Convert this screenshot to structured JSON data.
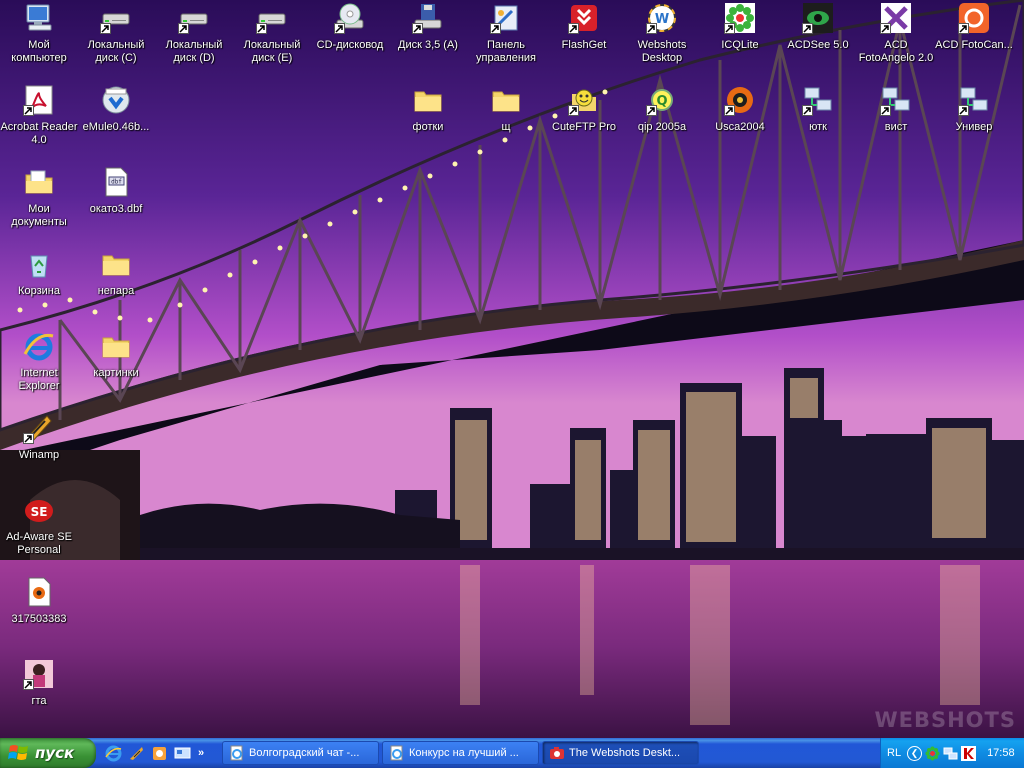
{
  "desktop": {
    "wallpaper_watermark": "WEBSHOTS",
    "icons": [
      {
        "id": "my-computer",
        "label": "Мой компьютер",
        "shortcut": false
      },
      {
        "id": "local-disk-c",
        "label": "Локальный диск (C)",
        "shortcut": true
      },
      {
        "id": "local-disk-d",
        "label": "Локальный диск (D)",
        "shortcut": true
      },
      {
        "id": "local-disk-e",
        "label": "Локальный диск (E)",
        "shortcut": true
      },
      {
        "id": "cd-drive",
        "label": "CD-дисковод",
        "shortcut": true
      },
      {
        "id": "floppy-a",
        "label": "Диск 3,5 (A)",
        "shortcut": true
      },
      {
        "id": "control-panel",
        "label": "Панель управления",
        "shortcut": true
      },
      {
        "id": "flashget",
        "label": "FlashGet",
        "shortcut": true
      },
      {
        "id": "webshots",
        "label": "Webshots Desktop",
        "shortcut": true
      },
      {
        "id": "icqlite",
        "label": "ICQLite",
        "shortcut": true
      },
      {
        "id": "acdsee",
        "label": "ACDSee 5.0",
        "shortcut": true
      },
      {
        "id": "fotoangelo",
        "label": "ACD FotoAngelo 2.0",
        "shortcut": true
      },
      {
        "id": "fotocanvas",
        "label": "ACD FotoCan...",
        "shortcut": true
      },
      {
        "id": "acrobat",
        "label": "Acrobat Reader 4.0",
        "shortcut": true
      },
      {
        "id": "emule",
        "label": "eMule0.46b...",
        "shortcut": false
      },
      {
        "id": "fotki",
        "label": "фотки",
        "shortcut": false
      },
      {
        "id": "sch",
        "label": "щ",
        "shortcut": false
      },
      {
        "id": "cuteftp",
        "label": "CuteFTP Pro",
        "shortcut": true
      },
      {
        "id": "qip",
        "label": "qip 2005a",
        "shortcut": true
      },
      {
        "id": "usca",
        "label": "Usca2004",
        "shortcut": true
      },
      {
        "id": "yutk",
        "label": "ютк",
        "shortcut": true
      },
      {
        "id": "vist",
        "label": "вист",
        "shortcut": true
      },
      {
        "id": "univer",
        "label": "Универ",
        "shortcut": true
      },
      {
        "id": "my-documents",
        "label": "Мои документы",
        "shortcut": false
      },
      {
        "id": "okato",
        "label": "окато3.dbf",
        "shortcut": false
      },
      {
        "id": "recycle-bin",
        "label": "Корзина",
        "shortcut": false
      },
      {
        "id": "nepara",
        "label": "непара",
        "shortcut": false
      },
      {
        "id": "internet-explorer",
        "label": "Internet Explorer",
        "shortcut": false
      },
      {
        "id": "kartinki",
        "label": "картинки",
        "shortcut": false
      },
      {
        "id": "winamp",
        "label": "Winamp",
        "shortcut": true
      },
      {
        "id": "adaware",
        "label": "Ad-Aware SE Personal",
        "shortcut": false
      },
      {
        "id": "file-317503383",
        "label": "317503383",
        "shortcut": false
      },
      {
        "id": "gta",
        "label": "гта",
        "shortcut": true
      }
    ]
  },
  "taskbar": {
    "start_label": "пуск",
    "quick_launch": [
      "internet-explorer-icon",
      "winamp-icon",
      "acdsee-icon",
      "show-desktop-icon"
    ],
    "overflow_label": "»",
    "tasks": [
      {
        "label": "Волгоградский чат -...",
        "icon": "ie-page-icon",
        "active": false
      },
      {
        "label": "Конкурс на лучший ...",
        "icon": "ie-page-icon",
        "active": false
      },
      {
        "label": "The Webshots Deskt...",
        "icon": "camera-icon",
        "active": true
      }
    ],
    "tray": {
      "language": "RL",
      "icons": [
        "icq-tray-icon",
        "network-tray-icon",
        "kaspersky-tray-icon"
      ],
      "clock": "17:58"
    }
  },
  "colors": {
    "taskbar": "#2258d4",
    "start": "#3a9235",
    "tray": "#0f8ce3"
  }
}
